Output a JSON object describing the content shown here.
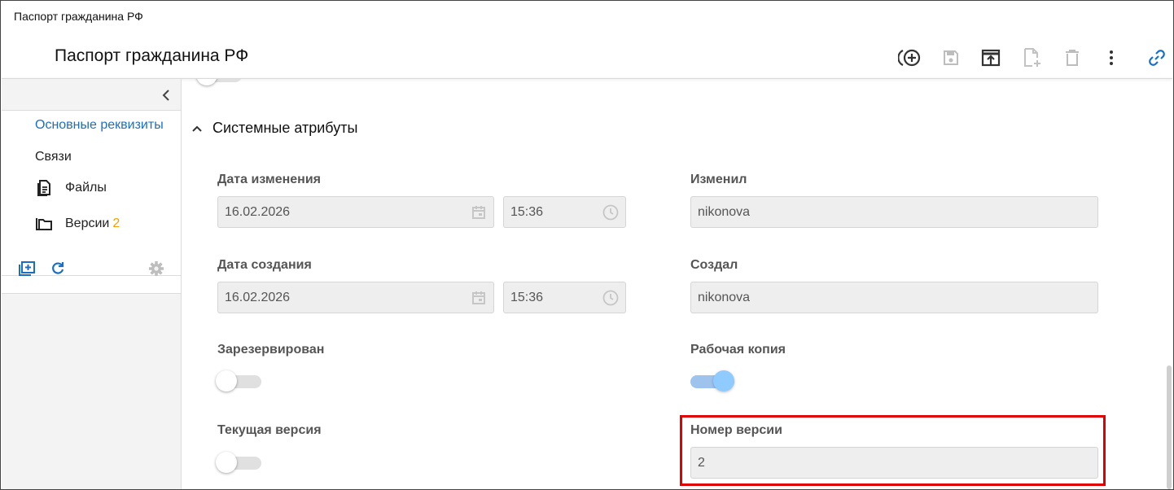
{
  "window": {
    "title": "Паспорт гражданина РФ"
  },
  "header": {
    "title": "Паспорт гражданина РФ"
  },
  "toolbar": {
    "buttons": [
      {
        "name": "create-icon",
        "enabled": true
      },
      {
        "name": "save-icon",
        "enabled": false
      },
      {
        "name": "open-icon",
        "enabled": true
      },
      {
        "name": "new-document-icon",
        "enabled": false
      },
      {
        "name": "delete-icon",
        "enabled": false
      },
      {
        "name": "more-icon",
        "enabled": true
      },
      {
        "name": "link-icon",
        "enabled": true
      }
    ]
  },
  "sidebar": {
    "items": [
      {
        "label": "Основные реквизиты",
        "active": true
      },
      {
        "label": "Связи"
      },
      {
        "label": "Файлы",
        "icon": "document-icon"
      },
      {
        "label": "Версии",
        "icon": "folder-icon",
        "badge": "2"
      }
    ],
    "tools": [
      "add-folder-icon",
      "refresh-icon",
      "settings-icon"
    ]
  },
  "section": {
    "title": "Системные атрибуты",
    "expanded": true
  },
  "fields": {
    "modified_date": {
      "label": "Дата изменения",
      "date": "16.02.2026",
      "time": "15:36"
    },
    "modified_by": {
      "label": "Изменил",
      "value": "nikonova"
    },
    "created_date": {
      "label": "Дата создания",
      "date": "16.02.2026",
      "time": "15:36"
    },
    "created_by": {
      "label": "Создал",
      "value": "nikonova"
    },
    "reserved": {
      "label": "Зарезервирован",
      "checked": false
    },
    "working_copy": {
      "label": "Рабочая копия",
      "checked": true
    },
    "current_version": {
      "label": "Текущая версия",
      "checked": false
    },
    "version_number": {
      "label": "Номер версии",
      "value": "2"
    }
  },
  "colors": {
    "accent": "#1a6fc4",
    "badge": "#f5a000",
    "highlight": "#e00000",
    "toggle_on": "#8fcbff"
  }
}
